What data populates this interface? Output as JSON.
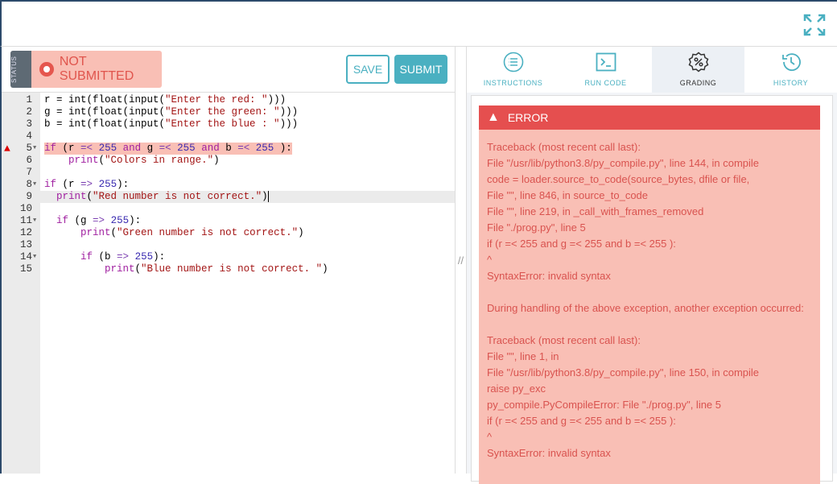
{
  "status": {
    "tag": "STATUS",
    "label": "NOT SUBMITTED"
  },
  "buttons": {
    "save": "SAVE",
    "submit": "SUBMIT"
  },
  "editor": {
    "lines": [
      "r = int(float(input(\"Enter the red: \")))",
      "g = int(float(input(\"Enter the green: \")))",
      "b = int(float(input(\"Enter the blue : \")))",
      "",
      "if (r =< 255 and g =< 255 and b =< 255 ):",
      "    print(\"Colors in range.\")",
      "",
      "if (r => 255):",
      "  print(\"Red number is not correct.\")",
      "",
      "  if (g => 255):",
      "      print(\"Green number is not correct.\")",
      "",
      "      if (b => 255):",
      "          print(\"Blue number is not correct. \")"
    ],
    "fold_lines": [
      5,
      8,
      11,
      14
    ],
    "error_line": 5,
    "active_line": 9
  },
  "tabs": [
    {
      "label": "INSTRUCTIONS",
      "icon": "list-icon"
    },
    {
      "label": "RUN CODE",
      "icon": "terminal-icon"
    },
    {
      "label": "GRADING",
      "icon": "percent-badge-icon",
      "active": true
    },
    {
      "label": "HISTORY",
      "icon": "history-icon"
    }
  ],
  "error": {
    "title": "ERROR",
    "lines": [
      "Traceback (most recent call last):",
      "File \"/usr/lib/python3.8/py_compile.py\", line 144, in compile",
      "code = loader.source_to_code(source_bytes, dfile or file,",
      "File \"\", line 846, in source_to_code",
      "File \"\", line 219, in _call_with_frames_removed",
      "File \"./prog.py\", line 5",
      "if (r =< 255 and g =< 255 and b =< 255 ):",
      "^",
      "SyntaxError: invalid syntax",
      "",
      "During handling of the above exception, another exception occurred:",
      "",
      "Traceback (most recent call last):",
      "File \"\", line 1, in",
      "File \"/usr/lib/python3.8/py_compile.py\", line 150, in compile",
      "raise py_exc",
      "py_compile.PyCompileError: File \"./prog.py\", line 5",
      "if (r =< 255 and g =< 255 and b =< 255 ):",
      "^",
      "SyntaxError: invalid syntax"
    ]
  },
  "splitter": "//"
}
